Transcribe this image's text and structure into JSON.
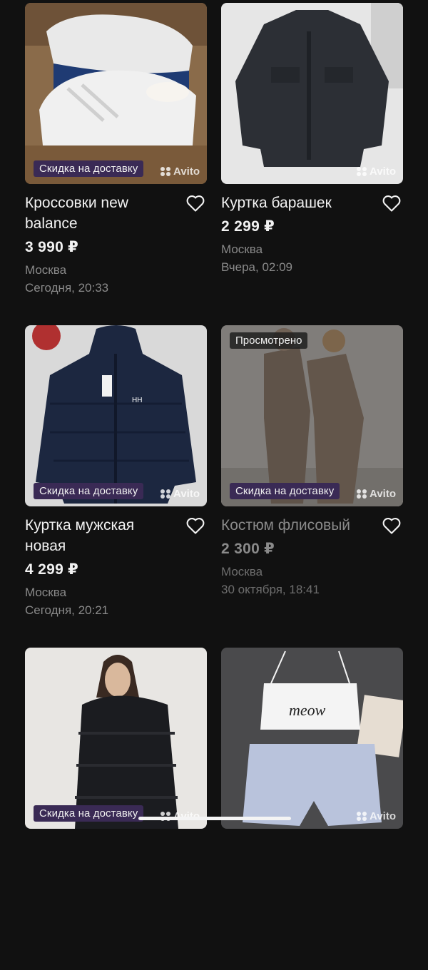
{
  "listings": [
    {
      "title": "Кроссовки new balance",
      "price": "3 990 ₽",
      "city": "Москва",
      "date": "Сегодня, 20:33",
      "badge": "Скидка на доставку",
      "viewed": false,
      "watermark": "Avito"
    },
    {
      "title": "Куртка барашек",
      "price": "2 299 ₽",
      "city": "Москва",
      "date": "Вчера, 02:09",
      "badge": "",
      "viewed": false,
      "watermark": "Avito"
    },
    {
      "title": "Куртка мужская новая",
      "price": "4 299 ₽",
      "city": "Москва",
      "date": "Сегодня, 20:21",
      "badge": "Скидка на доставку",
      "viewed": false,
      "watermark": "Avito"
    },
    {
      "title": "Костюм флисовый",
      "price": "2 300 ₽",
      "city": "Москва",
      "date": "30 октября, 18:41",
      "badge": "Скидка на доставку",
      "viewed": true,
      "viewed_label": "Просмотрено",
      "watermark": "Avito"
    },
    {
      "badge": "Скидка на доставку",
      "viewed": false,
      "watermark": "Avito"
    },
    {
      "badge": "",
      "viewed": false,
      "watermark": "Avito"
    }
  ],
  "icons": {
    "favorite": "heart-outline-icon"
  },
  "colors": {
    "background": "#111111",
    "badge": "#3a2a55",
    "muted": "#8a8a8a"
  }
}
